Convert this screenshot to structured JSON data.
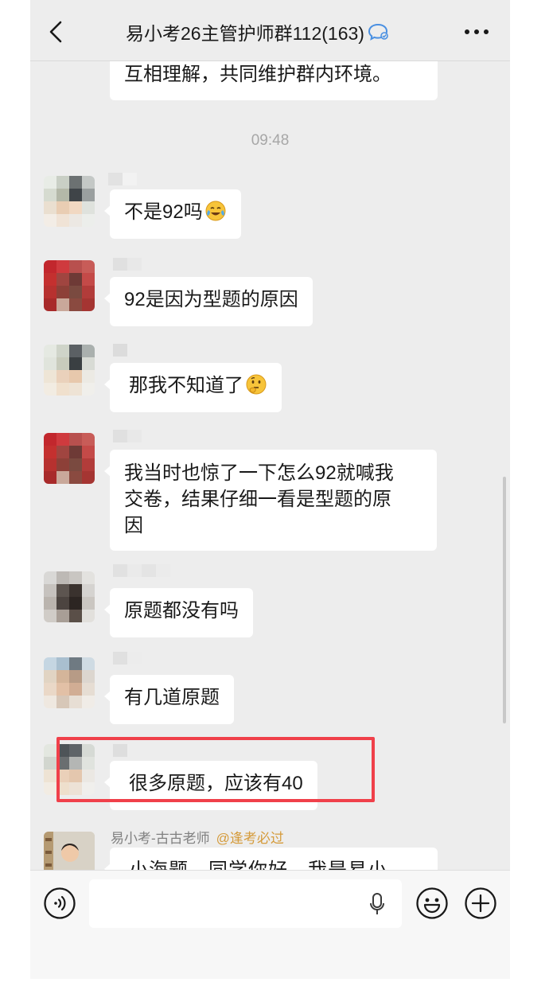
{
  "header": {
    "title": "易小考26主管护师群112(163)",
    "back_icon": "chevron-left-icon",
    "verified_icon": "chat-verified-icon",
    "more_icon": "more-dots-icon"
  },
  "chat": {
    "top_partial_message": "互相理解，共同维护群内环境。",
    "timestamp": "09:48",
    "messages": [
      {
        "text": "不是92吗",
        "emoji": "crying-laughing-face-emoji"
      },
      {
        "text": "92是因为型题的原因"
      },
      {
        "text": "那我不知道了",
        "emoji": "thinking-face-emoji"
      },
      {
        "text_lines": [
          "我当时也惊了一下怎么92就喊我",
          "交卷，结果仔细一看是型题的原",
          "因"
        ]
      },
      {
        "text": "原题都没有吗"
      },
      {
        "text": "有几道原题"
      },
      {
        "text": "很多原题，应该有40"
      }
    ],
    "last_sender": {
      "name": "易小考-古古老师",
      "tag": "@逢考必过"
    },
    "last_partial_message": "小海题，同学你好，我是易小",
    "highlight_color": "#f0404a"
  },
  "input_bar": {
    "voice_icon": "voice-input-icon",
    "mic_icon": "microphone-icon",
    "emoji_icon": "emoji-face-icon",
    "plus_icon": "plus-circle-icon"
  }
}
